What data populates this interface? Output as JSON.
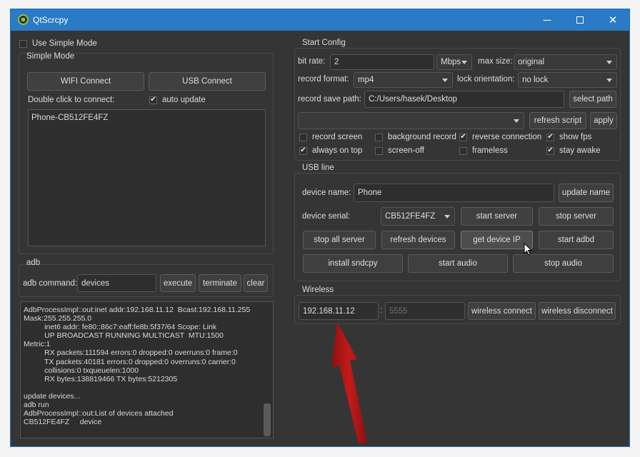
{
  "window": {
    "title": "QtScrcpy",
    "min_icon": "minimize-icon",
    "max_icon": "maximize-icon",
    "close_icon": "close-icon"
  },
  "simple": {
    "use_simple_mode": "Use Simple Mode",
    "group_title": "Simple Mode",
    "wifi_connect": "WIFI Connect",
    "usb_connect": "USB Connect",
    "double_click": "Double click to connect:",
    "auto_update": "auto update",
    "devices": [
      "Phone-CB512FE4FZ"
    ]
  },
  "adb": {
    "group_title": "adb",
    "command_label": "adb command:",
    "command_value": "devices",
    "execute": "execute",
    "terminate": "terminate",
    "clear": "clear",
    "log": "AdbProcessImpl::out:inet addr:192.168.11.12  Bcast:192.168.11.255\nMask:255.255.255.0\n          inet6 addr: fe80::86c7:eaff:fe8b:5f37/64 Scope: Link\n          UP BROADCAST RUNNING MULTICAST  MTU:1500\nMetric:1\n          RX packets:111594 errors:0 dropped:0 overruns:0 frame:0\n          TX packets:40181 errors:0 dropped:0 overruns:0 carrier:0\n          collisions:0 txqueuelen:1000\n          RX bytes:138819466 TX bytes:5212305\n\nupdate devices...\nadb run\nAdbProcessImpl::out:List of devices attached\nCB512FE4FZ     device"
  },
  "start_config": {
    "group_title": "Start Config",
    "bit_rate_label": "bit rate:",
    "bit_rate_value": "2",
    "bit_rate_unit": "Mbps",
    "max_size_label": "max size:",
    "max_size_value": "original",
    "record_format_label": "record format:",
    "record_format_value": "mp4",
    "lock_orientation_label": "lock orientation:",
    "lock_orientation_value": "no lock",
    "record_save_path_label": "record save path:",
    "record_save_path_value": "C:/Users/hasek/Desktop",
    "select_path": "select path",
    "script_value": "",
    "refresh_script": "refresh script",
    "apply": "apply",
    "checks": [
      {
        "label": "record screen",
        "checked": false
      },
      {
        "label": "background record",
        "checked": false
      },
      {
        "label": "reverse connection",
        "checked": true
      },
      {
        "label": "show fps",
        "checked": true
      },
      {
        "label": "always on top",
        "checked": true
      },
      {
        "label": "screen-off",
        "checked": false
      },
      {
        "label": "frameless",
        "checked": false
      },
      {
        "label": "stay awake",
        "checked": true
      }
    ]
  },
  "usb_line": {
    "group_title": "USB line",
    "device_name_label": "device name:",
    "device_name_value": "Phone",
    "update_name": "update name",
    "device_serial_label": "device serial:",
    "device_serial_value": "CB512FE4FZ",
    "start_server": "start server",
    "stop_server": "stop server",
    "stop_all_server": "stop all server",
    "refresh_devices": "refresh devices",
    "get_device_ip": "get device IP",
    "start_adbd": "start adbd",
    "install_sndcpy": "install sndcpy",
    "start_audio": "start audio",
    "stop_audio": "stop audio"
  },
  "wireless": {
    "group_title": "Wireless",
    "ip_value": "192.168.11.12",
    "separator": ":",
    "port_placeholder": "5555",
    "wireless_connect": "wireless connect",
    "wireless_disconnect": "wireless disconnect"
  },
  "annotation": {
    "arrow_color": "#b01515",
    "cursor_icon": "mouse-pointer-icon"
  }
}
